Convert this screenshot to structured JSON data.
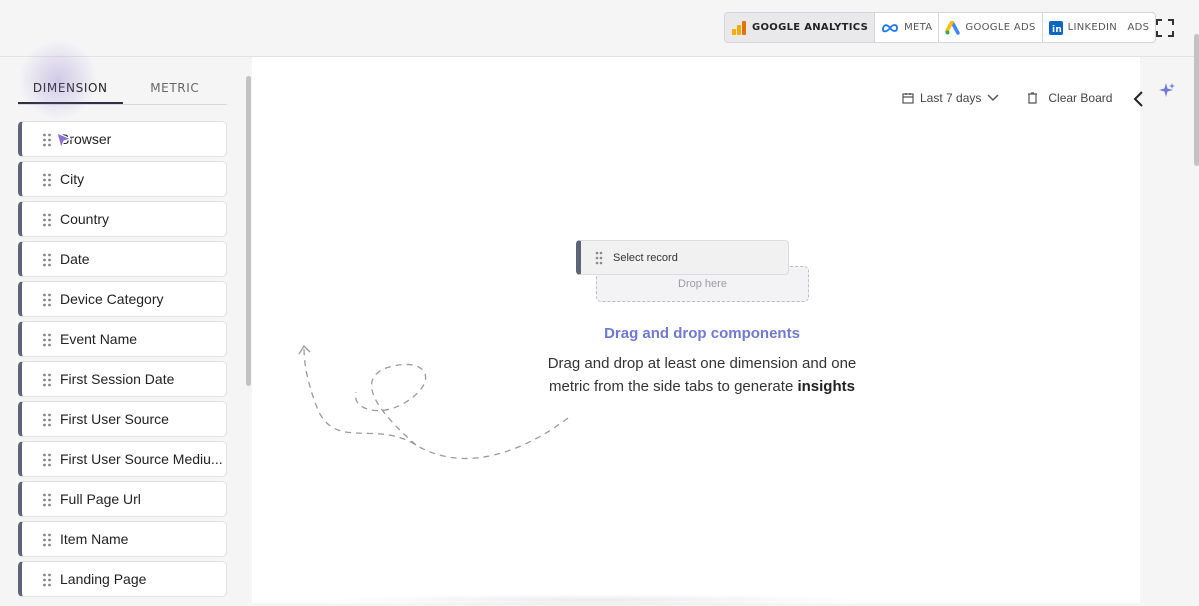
{
  "sources": [
    {
      "label": "GOOGLE ANALYTICS",
      "icon": "google-analytics-icon",
      "active": true
    },
    {
      "label": "META",
      "icon": "meta-icon",
      "active": false
    },
    {
      "label": "GOOGLE ADS",
      "icon": "google-ads-icon",
      "active": false
    },
    {
      "label": "LINKEDIN   ADS",
      "icon": "linkedin-icon",
      "active": false
    }
  ],
  "sidebar": {
    "tabs": [
      "DIMENSION",
      "METRIC"
    ],
    "active_tab": "DIMENSION",
    "items": [
      "Browser",
      "City",
      "Country",
      "Date",
      "Device Category",
      "Event Name",
      "First Session Date",
      "First User Source",
      "First User Source Mediu...",
      "Full Page Url",
      "Item Name",
      "Landing Page"
    ]
  },
  "controls": {
    "date_range": "Last 7 days",
    "clear_board": "Clear Board"
  },
  "canvas": {
    "record_label": "Select record",
    "drop_label": "Drop here",
    "heading": "Drag and drop components",
    "description": "Drag and drop at least one dimension and one metric from the side tabs to generate",
    "description_bold": "insights"
  },
  "colors": {
    "accent": "#7079d6",
    "item_bar": "#5e6578"
  }
}
